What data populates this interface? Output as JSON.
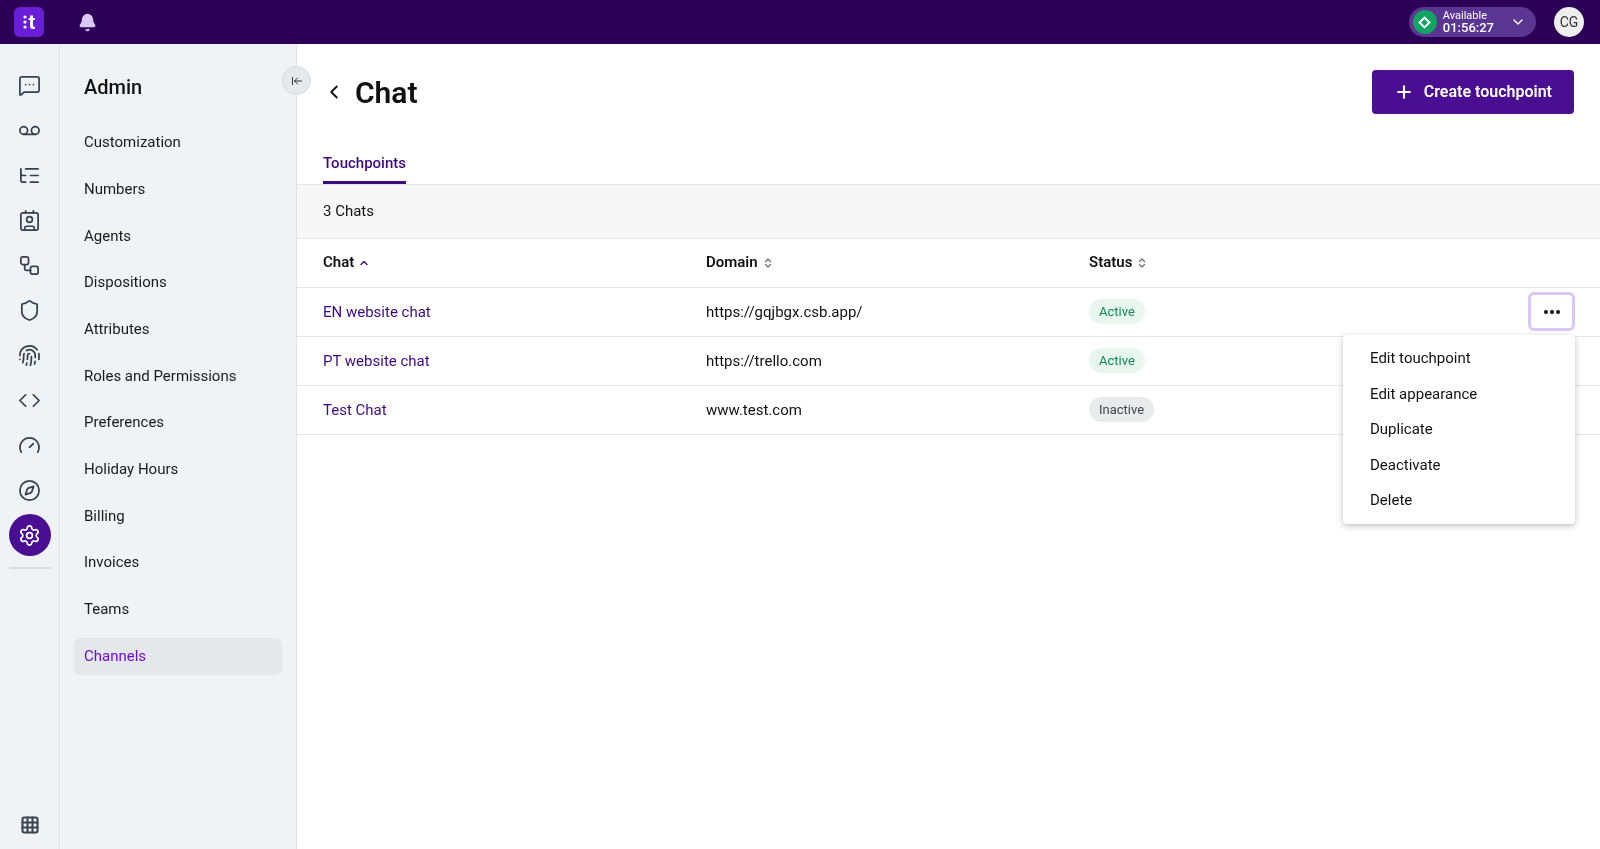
{
  "topbar": {
    "logo": "t",
    "status": {
      "label": "Available",
      "timer": "01:56:27"
    },
    "avatar": "CG"
  },
  "rail": [
    {
      "kind": "agents",
      "selected": false
    },
    {
      "kind": "voicemail",
      "selected": false
    },
    {
      "kind": "queues",
      "selected": false
    },
    {
      "kind": "contacts",
      "selected": false
    },
    {
      "kind": "flows",
      "selected": false
    },
    {
      "kind": "shield",
      "selected": false
    },
    {
      "kind": "fingerprint",
      "selected": false
    },
    {
      "kind": "code",
      "selected": false
    },
    {
      "kind": "gauge",
      "selected": false
    },
    {
      "kind": "compass",
      "selected": false
    },
    {
      "kind": "settings",
      "selected": true
    }
  ],
  "sidebar": {
    "title": "Admin",
    "items": [
      {
        "label": "Customization",
        "selected": false
      },
      {
        "label": "Numbers",
        "selected": false
      },
      {
        "label": "Agents",
        "selected": false
      },
      {
        "label": "Dispositions",
        "selected": false
      },
      {
        "label": "Attributes",
        "selected": false
      },
      {
        "label": "Roles and Permissions",
        "selected": false
      },
      {
        "label": "Preferences",
        "selected": false
      },
      {
        "label": "Holiday Hours",
        "selected": false
      },
      {
        "label": "Billing",
        "selected": false
      },
      {
        "label": "Invoices",
        "selected": false
      },
      {
        "label": "Teams",
        "selected": false
      },
      {
        "label": "Channels",
        "selected": true
      }
    ]
  },
  "page": {
    "title": "Chat",
    "create_button": "Create touchpoint"
  },
  "tabs": [
    {
      "label": "Touchpoints",
      "selected": true
    }
  ],
  "count": "3 Chats",
  "table": {
    "columns": [
      {
        "label": "Chat",
        "sorted": true
      },
      {
        "label": "Domain",
        "sorted": false
      },
      {
        "label": "Status",
        "sorted": false
      }
    ],
    "rows": [
      {
        "chat": "EN website chat",
        "domain": "https://gqjbgx.csb.app/",
        "status": "Active",
        "active": true,
        "menu_open": true
      },
      {
        "chat": "PT website chat",
        "domain": "https://trello.com",
        "status": "Active",
        "active": true,
        "menu_open": false
      },
      {
        "chat": "Test Chat",
        "domain": "www.test.com",
        "status": "Inactive",
        "active": false,
        "menu_open": false
      }
    ]
  },
  "row_menu": [
    "Edit touchpoint",
    "Edit appearance",
    "Duplicate",
    "Deactivate",
    "Delete"
  ]
}
